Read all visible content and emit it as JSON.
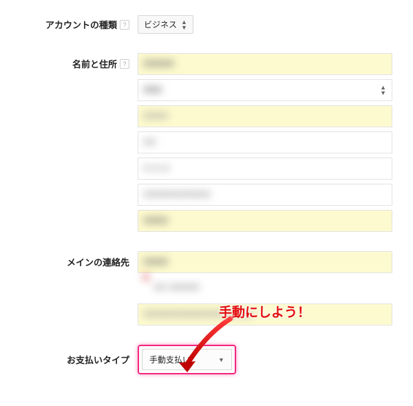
{
  "account_type": {
    "label": "アカウントの種類",
    "value": "ビジネス"
  },
  "name_address": {
    "label": "名前と住所"
  },
  "main_contact": {
    "label": "メインの連絡先"
  },
  "payment_type": {
    "label": "お支払いタイプ",
    "value": "手動支払い"
  },
  "annotation": {
    "text": "手動にしよう！"
  }
}
